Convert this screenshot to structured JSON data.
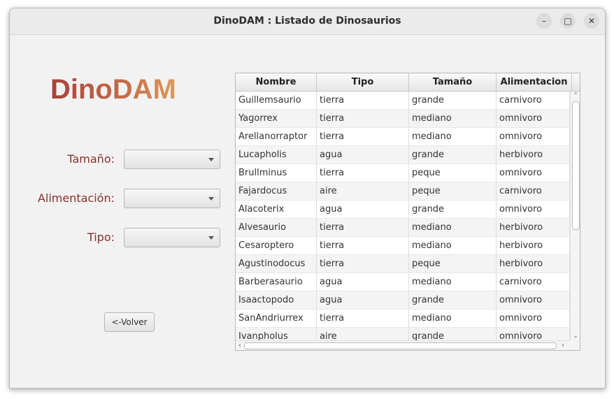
{
  "window": {
    "title": "DinoDAM : Listado de Dinosaurios",
    "minimize": "–",
    "maximize": "□",
    "close": "✕"
  },
  "logo": "DinoDAM",
  "filters": {
    "size_label": "Tamaño:",
    "food_label": "Alimentación:",
    "type_label": "Tipo:",
    "size_value": "",
    "food_value": "",
    "type_value": ""
  },
  "back_button": "<-Volver",
  "table": {
    "columns": [
      "Nombre",
      "Tipo",
      "Tamaño",
      "Alimentacion"
    ],
    "rows": [
      [
        "Guillemsaurio",
        "tierra",
        "grande",
        "carnivoro"
      ],
      [
        "Yagorrex",
        "tierra",
        "mediano",
        "omnivoro"
      ],
      [
        "Arellanorraptor",
        "tierra",
        "mediano",
        "omnivoro"
      ],
      [
        "Lucapholis",
        "agua",
        "grande",
        "herbivoro"
      ],
      [
        "Brullminus",
        "tierra",
        "peque",
        "omnivoro"
      ],
      [
        "Fajardocus",
        "aire",
        "peque",
        "carnivoro"
      ],
      [
        "Alacoterix",
        "agua",
        "grande",
        "omnivoro"
      ],
      [
        "Alvesaurio",
        "tierra",
        "mediano",
        "herbivoro"
      ],
      [
        "Cesaroptero",
        "tierra",
        "mediano",
        "herbivoro"
      ],
      [
        "Agustinodocus",
        "tierra",
        "peque",
        "herbivoro"
      ],
      [
        "Barberasaurio",
        "agua",
        "mediano",
        "carnivoro"
      ],
      [
        "Isaactopodo",
        "agua",
        "grande",
        "omnivoro"
      ],
      [
        "SanAndriurrex",
        "tierra",
        "mediano",
        "omnivoro"
      ],
      [
        "Ivanpholus",
        "aire",
        "grande",
        "omnivoro"
      ]
    ]
  }
}
